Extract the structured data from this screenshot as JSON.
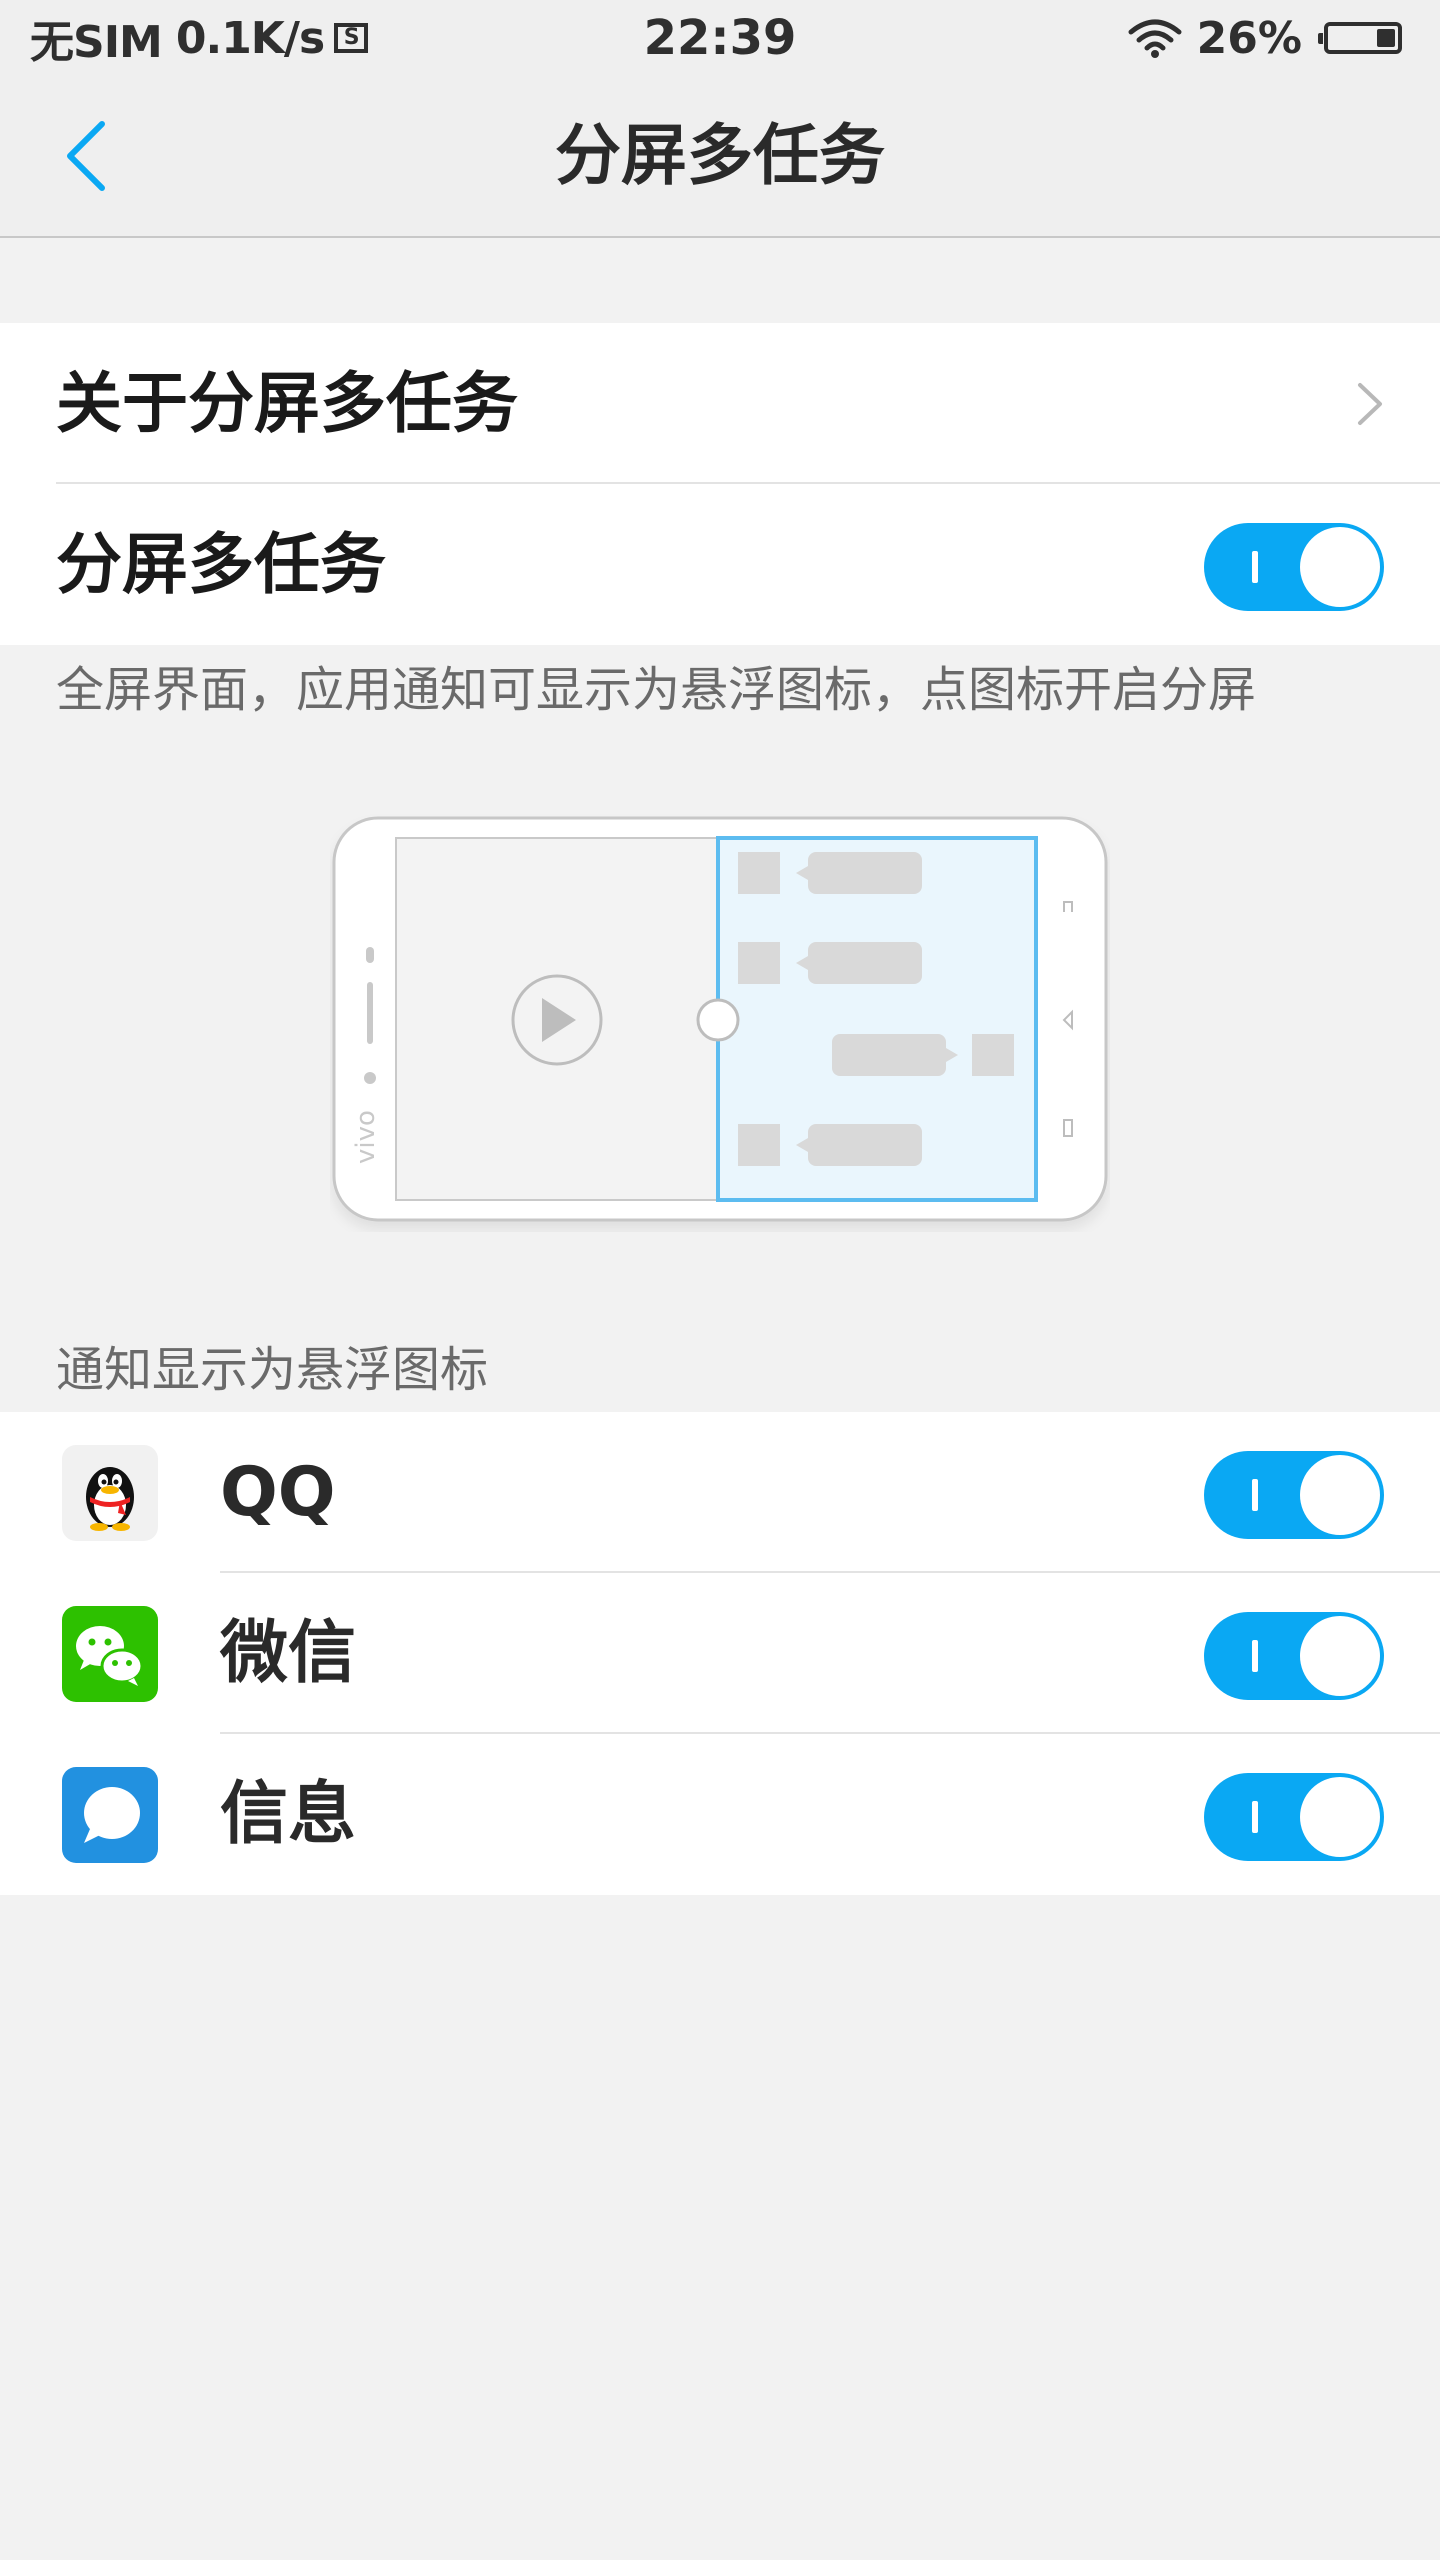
{
  "status_bar": {
    "carrier": "无SIM",
    "speed": "0.1K/s",
    "sim_icon_glyph": "S",
    "time": "22:39",
    "battery": "26%",
    "icons": [
      "sim-card-icon",
      "wifi-icon",
      "battery-icon"
    ]
  },
  "header": {
    "title": "分屏多任务",
    "back_icon": "chevron-left-icon"
  },
  "settings": {
    "about_label": "关于分屏多任务",
    "split_label": "分屏多任务",
    "split_enabled": true
  },
  "description": "全屏界面，应用通知可显示为悬浮图标，点图标开启分屏",
  "illustration": {
    "brand": "vivo",
    "icons": [
      "play-icon",
      "drag-handle-icon",
      "nav-menu-icon",
      "nav-home-icon",
      "nav-back-icon"
    ]
  },
  "section_header": "通知显示为悬浮图标",
  "apps": [
    {
      "name": "QQ",
      "icon": "qq-penguin-icon",
      "enabled": true
    },
    {
      "name": "微信",
      "icon": "wechat-icon",
      "enabled": true
    },
    {
      "name": "信息",
      "icon": "messages-icon",
      "enabled": true
    }
  ],
  "colors": {
    "accent": "#0aa8f3",
    "background": "#f2f2f2",
    "header_bg": "#efefef",
    "wechat_green": "#2dc100",
    "messages_blue": "#2291e0"
  }
}
